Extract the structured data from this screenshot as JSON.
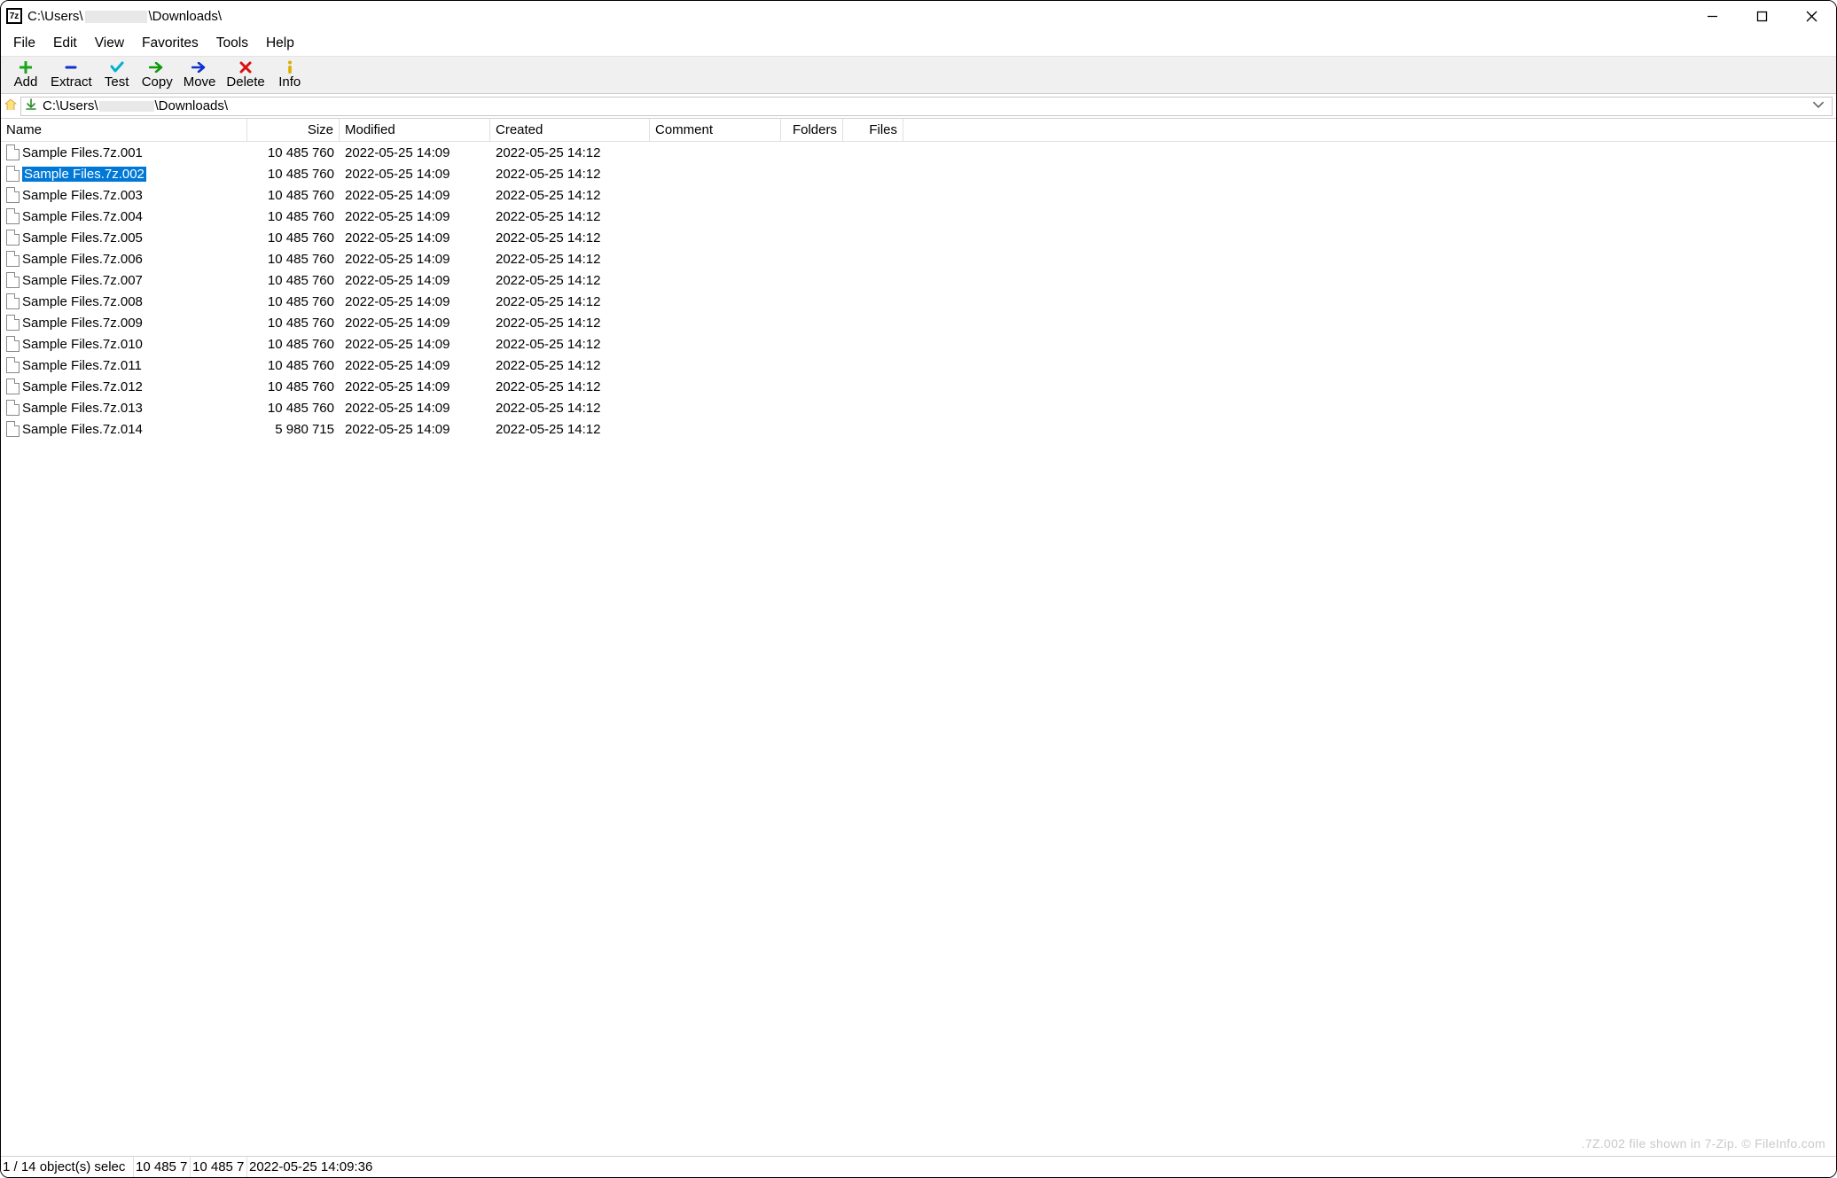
{
  "title": {
    "prefix": "C:\\Users\\",
    "redacted": true,
    "suffix": "\\Downloads\\"
  },
  "app_icon_text": "7z",
  "winbuttons": {
    "min": "min",
    "max": "max",
    "close": "close"
  },
  "menu": [
    "File",
    "Edit",
    "View",
    "Favorites",
    "Tools",
    "Help"
  ],
  "toolbar": [
    {
      "id": "add",
      "label": "Add"
    },
    {
      "id": "extract",
      "label": "Extract"
    },
    {
      "id": "test",
      "label": "Test"
    },
    {
      "id": "copy",
      "label": "Copy"
    },
    {
      "id": "move",
      "label": "Move"
    },
    {
      "id": "delete",
      "label": "Delete"
    },
    {
      "id": "info",
      "label": "Info"
    }
  ],
  "address": {
    "prefix": "C:\\Users\\",
    "redacted": true,
    "suffix": "\\Downloads\\"
  },
  "columns": {
    "name": "Name",
    "size": "Size",
    "modified": "Modified",
    "created": "Created",
    "comment": "Comment",
    "folders": "Folders",
    "files": "Files"
  },
  "rows": [
    {
      "name": "Sample Files.7z.001",
      "size": "10 485 760",
      "modified": "2022-05-25 14:09",
      "created": "2022-05-25 14:12",
      "selected": false
    },
    {
      "name": "Sample Files.7z.002",
      "size": "10 485 760",
      "modified": "2022-05-25 14:09",
      "created": "2022-05-25 14:12",
      "selected": true
    },
    {
      "name": "Sample Files.7z.003",
      "size": "10 485 760",
      "modified": "2022-05-25 14:09",
      "created": "2022-05-25 14:12",
      "selected": false
    },
    {
      "name": "Sample Files.7z.004",
      "size": "10 485 760",
      "modified": "2022-05-25 14:09",
      "created": "2022-05-25 14:12",
      "selected": false
    },
    {
      "name": "Sample Files.7z.005",
      "size": "10 485 760",
      "modified": "2022-05-25 14:09",
      "created": "2022-05-25 14:12",
      "selected": false
    },
    {
      "name": "Sample Files.7z.006",
      "size": "10 485 760",
      "modified": "2022-05-25 14:09",
      "created": "2022-05-25 14:12",
      "selected": false
    },
    {
      "name": "Sample Files.7z.007",
      "size": "10 485 760",
      "modified": "2022-05-25 14:09",
      "created": "2022-05-25 14:12",
      "selected": false
    },
    {
      "name": "Sample Files.7z.008",
      "size": "10 485 760",
      "modified": "2022-05-25 14:09",
      "created": "2022-05-25 14:12",
      "selected": false
    },
    {
      "name": "Sample Files.7z.009",
      "size": "10 485 760",
      "modified": "2022-05-25 14:09",
      "created": "2022-05-25 14:12",
      "selected": false
    },
    {
      "name": "Sample Files.7z.010",
      "size": "10 485 760",
      "modified": "2022-05-25 14:09",
      "created": "2022-05-25 14:12",
      "selected": false
    },
    {
      "name": "Sample Files.7z.011",
      "size": "10 485 760",
      "modified": "2022-05-25 14:09",
      "created": "2022-05-25 14:12",
      "selected": false
    },
    {
      "name": "Sample Files.7z.012",
      "size": "10 485 760",
      "modified": "2022-05-25 14:09",
      "created": "2022-05-25 14:12",
      "selected": false
    },
    {
      "name": "Sample Files.7z.013",
      "size": "10 485 760",
      "modified": "2022-05-25 14:09",
      "created": "2022-05-25 14:12",
      "selected": false
    },
    {
      "name": "Sample Files.7z.014",
      "size": "5 980 715",
      "modified": "2022-05-25 14:09",
      "created": "2022-05-25 14:12",
      "selected": false
    }
  ],
  "watermark": ".7Z.002 file shown in 7-Zip. © FileInfo.com",
  "status": {
    "seg1": "1 / 14 object(s) selec",
    "seg2": "10 485 7",
    "seg3": "10 485 7",
    "seg4": "2022-05-25 14:09:36"
  }
}
